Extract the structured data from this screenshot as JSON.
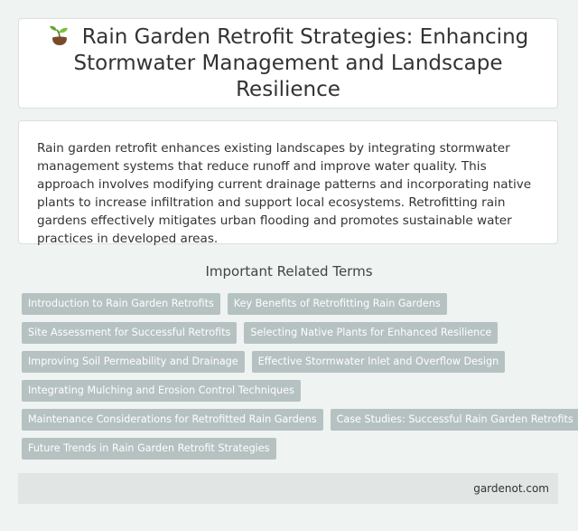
{
  "header": {
    "title": "Rain Garden Retrofit Strategies: Enhancing Stormwater Management and Landscape Resilience",
    "icon": "sprout-icon"
  },
  "intro": {
    "text": "Rain garden retrofit enhances existing landscapes by integrating stormwater management systems that reduce runoff and improve water quality. This approach involves modifying current drainage patterns and incorporating native plants to increase infiltration and support local ecosystems. Retrofitting rain gardens effectively mitigates urban flooding and promotes sustainable water practices in developed areas."
  },
  "related": {
    "heading": "Important Related Terms",
    "tags": [
      "Introduction to Rain Garden Retrofits",
      "Key Benefits of Retrofitting Rain Gardens",
      "Site Assessment for Successful Retrofits",
      "Selecting Native Plants for Enhanced Resilience",
      "Improving Soil Permeability and Drainage",
      "Effective Stormwater Inlet and Overflow Design",
      "Integrating Mulching and Erosion Control Techniques",
      "Maintenance Considerations for Retrofitted Rain Gardens",
      "Case Studies: Successful Rain Garden Retrofits",
      "Future Trends in Rain Garden Retrofit Strategies"
    ]
  },
  "footer": {
    "site": "gardenot.com"
  },
  "colors": {
    "background": "#eff3f1",
    "tag": "#b5c2c1",
    "footer": "#e1e5e3"
  }
}
